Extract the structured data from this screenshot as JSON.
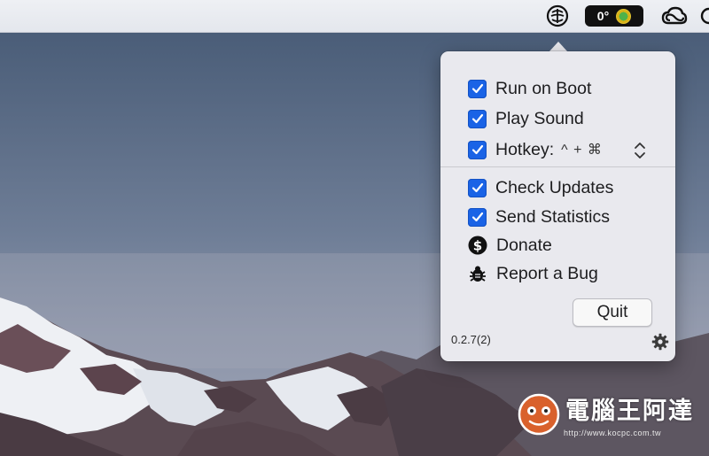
{
  "menubar": {
    "temperature": "0°"
  },
  "popover": {
    "items": [
      {
        "label": "Run on Boot",
        "checked": true
      },
      {
        "label": "Play Sound",
        "checked": true
      },
      {
        "label": "Hotkey:",
        "checked": true,
        "modifiers": "^ + ⌘"
      },
      {
        "label": "Check Updates",
        "checked": true
      },
      {
        "label": "Send Statistics",
        "checked": true
      }
    ],
    "donate_label": "Donate",
    "report_bug_label": "Report a Bug",
    "quit_label": "Quit",
    "version": "0.2.7(2)"
  },
  "watermark": {
    "title": "電腦王阿達",
    "url": "http://www.kocpc.com.tw"
  },
  "colors": {
    "checkbox": "#1a63e6",
    "popover_bg": "#e9e9ee",
    "menubar_bg": "#e4e7ed"
  }
}
